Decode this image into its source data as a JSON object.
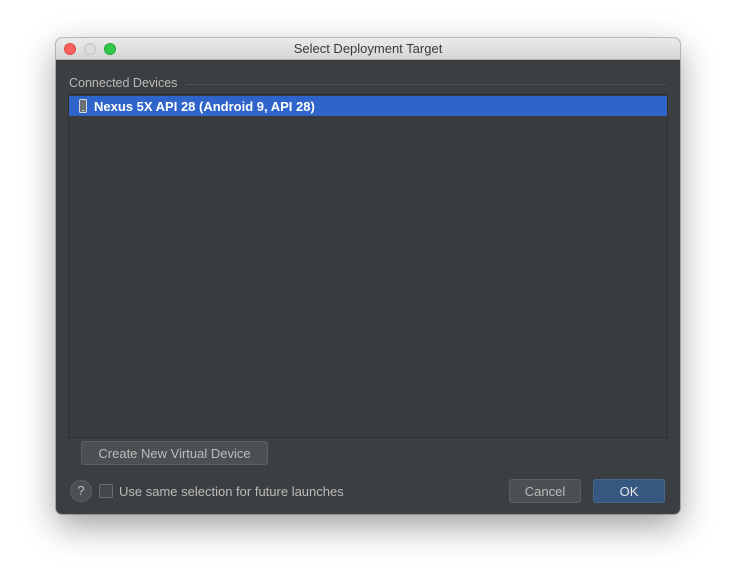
{
  "window": {
    "title": "Select Deployment Target"
  },
  "section": {
    "label": "Connected Devices"
  },
  "devices": [
    {
      "label": "Nexus 5X API 28 (Android 9, API 28)",
      "icon": "phone-icon",
      "selected": true
    }
  ],
  "actions": {
    "create_virtual_device": "Create New Virtual Device",
    "help": "?",
    "remember_label": "Use same selection for future launches",
    "remember_checked": false,
    "cancel": "Cancel",
    "ok": "OK"
  },
  "colors": {
    "background": "#3c3f41",
    "selection": "#2f65ca",
    "primary_button": "#365880",
    "close": "#fc605c",
    "maximize": "#34c84a"
  }
}
